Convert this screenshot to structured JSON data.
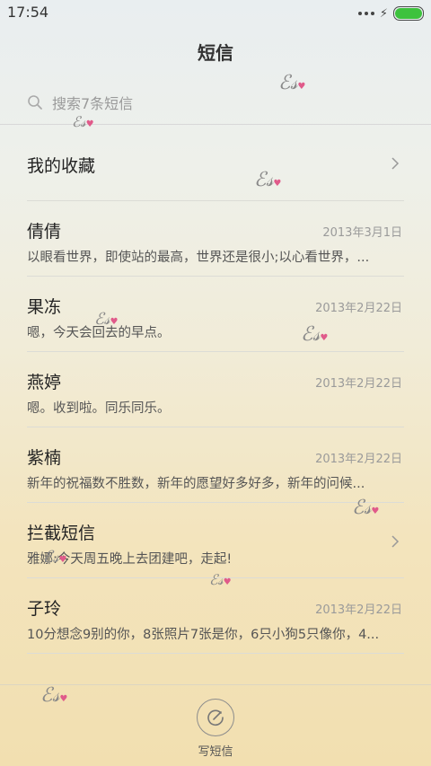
{
  "status_bar": {
    "time": "17:54",
    "battery_level": 1.0,
    "battery_color": "#3dc23d"
  },
  "header": {
    "title": "短信"
  },
  "search": {
    "placeholder": "搜索7条短信"
  },
  "favorites": {
    "label": "我的收藏"
  },
  "conversations": [
    {
      "name": "倩倩",
      "date": "2013年3月1日",
      "preview": "以眼看世界，即使站的最高，世界还是很小;以心看世界，..."
    },
    {
      "name": "果冻",
      "date": "2013年2月22日",
      "preview": "嗯，今天会回去的早点。"
    },
    {
      "name": "燕婷",
      "date": "2013年2月22日",
      "preview": "嗯。收到啦。同乐同乐。"
    },
    {
      "name": "紫楠",
      "date": "2013年2月22日",
      "preview": "新年的祝福数不胜数，新年的愿望好多好多，新年的问候..."
    },
    {
      "name": "拦截短信",
      "date": "",
      "preview": "雅娜:今天周五晚上去团建吧，走起!"
    },
    {
      "name": "子玲",
      "date": "2013年2月22日",
      "preview": "10分想念9别的你，8张照片7张是你，6只小狗5只像你，4..."
    }
  ],
  "compose": {
    "label": "写短信"
  },
  "colors": {
    "accent_heart": "#e05a8a",
    "text_primary": "#222222",
    "text_secondary": "#9a9a9a"
  }
}
